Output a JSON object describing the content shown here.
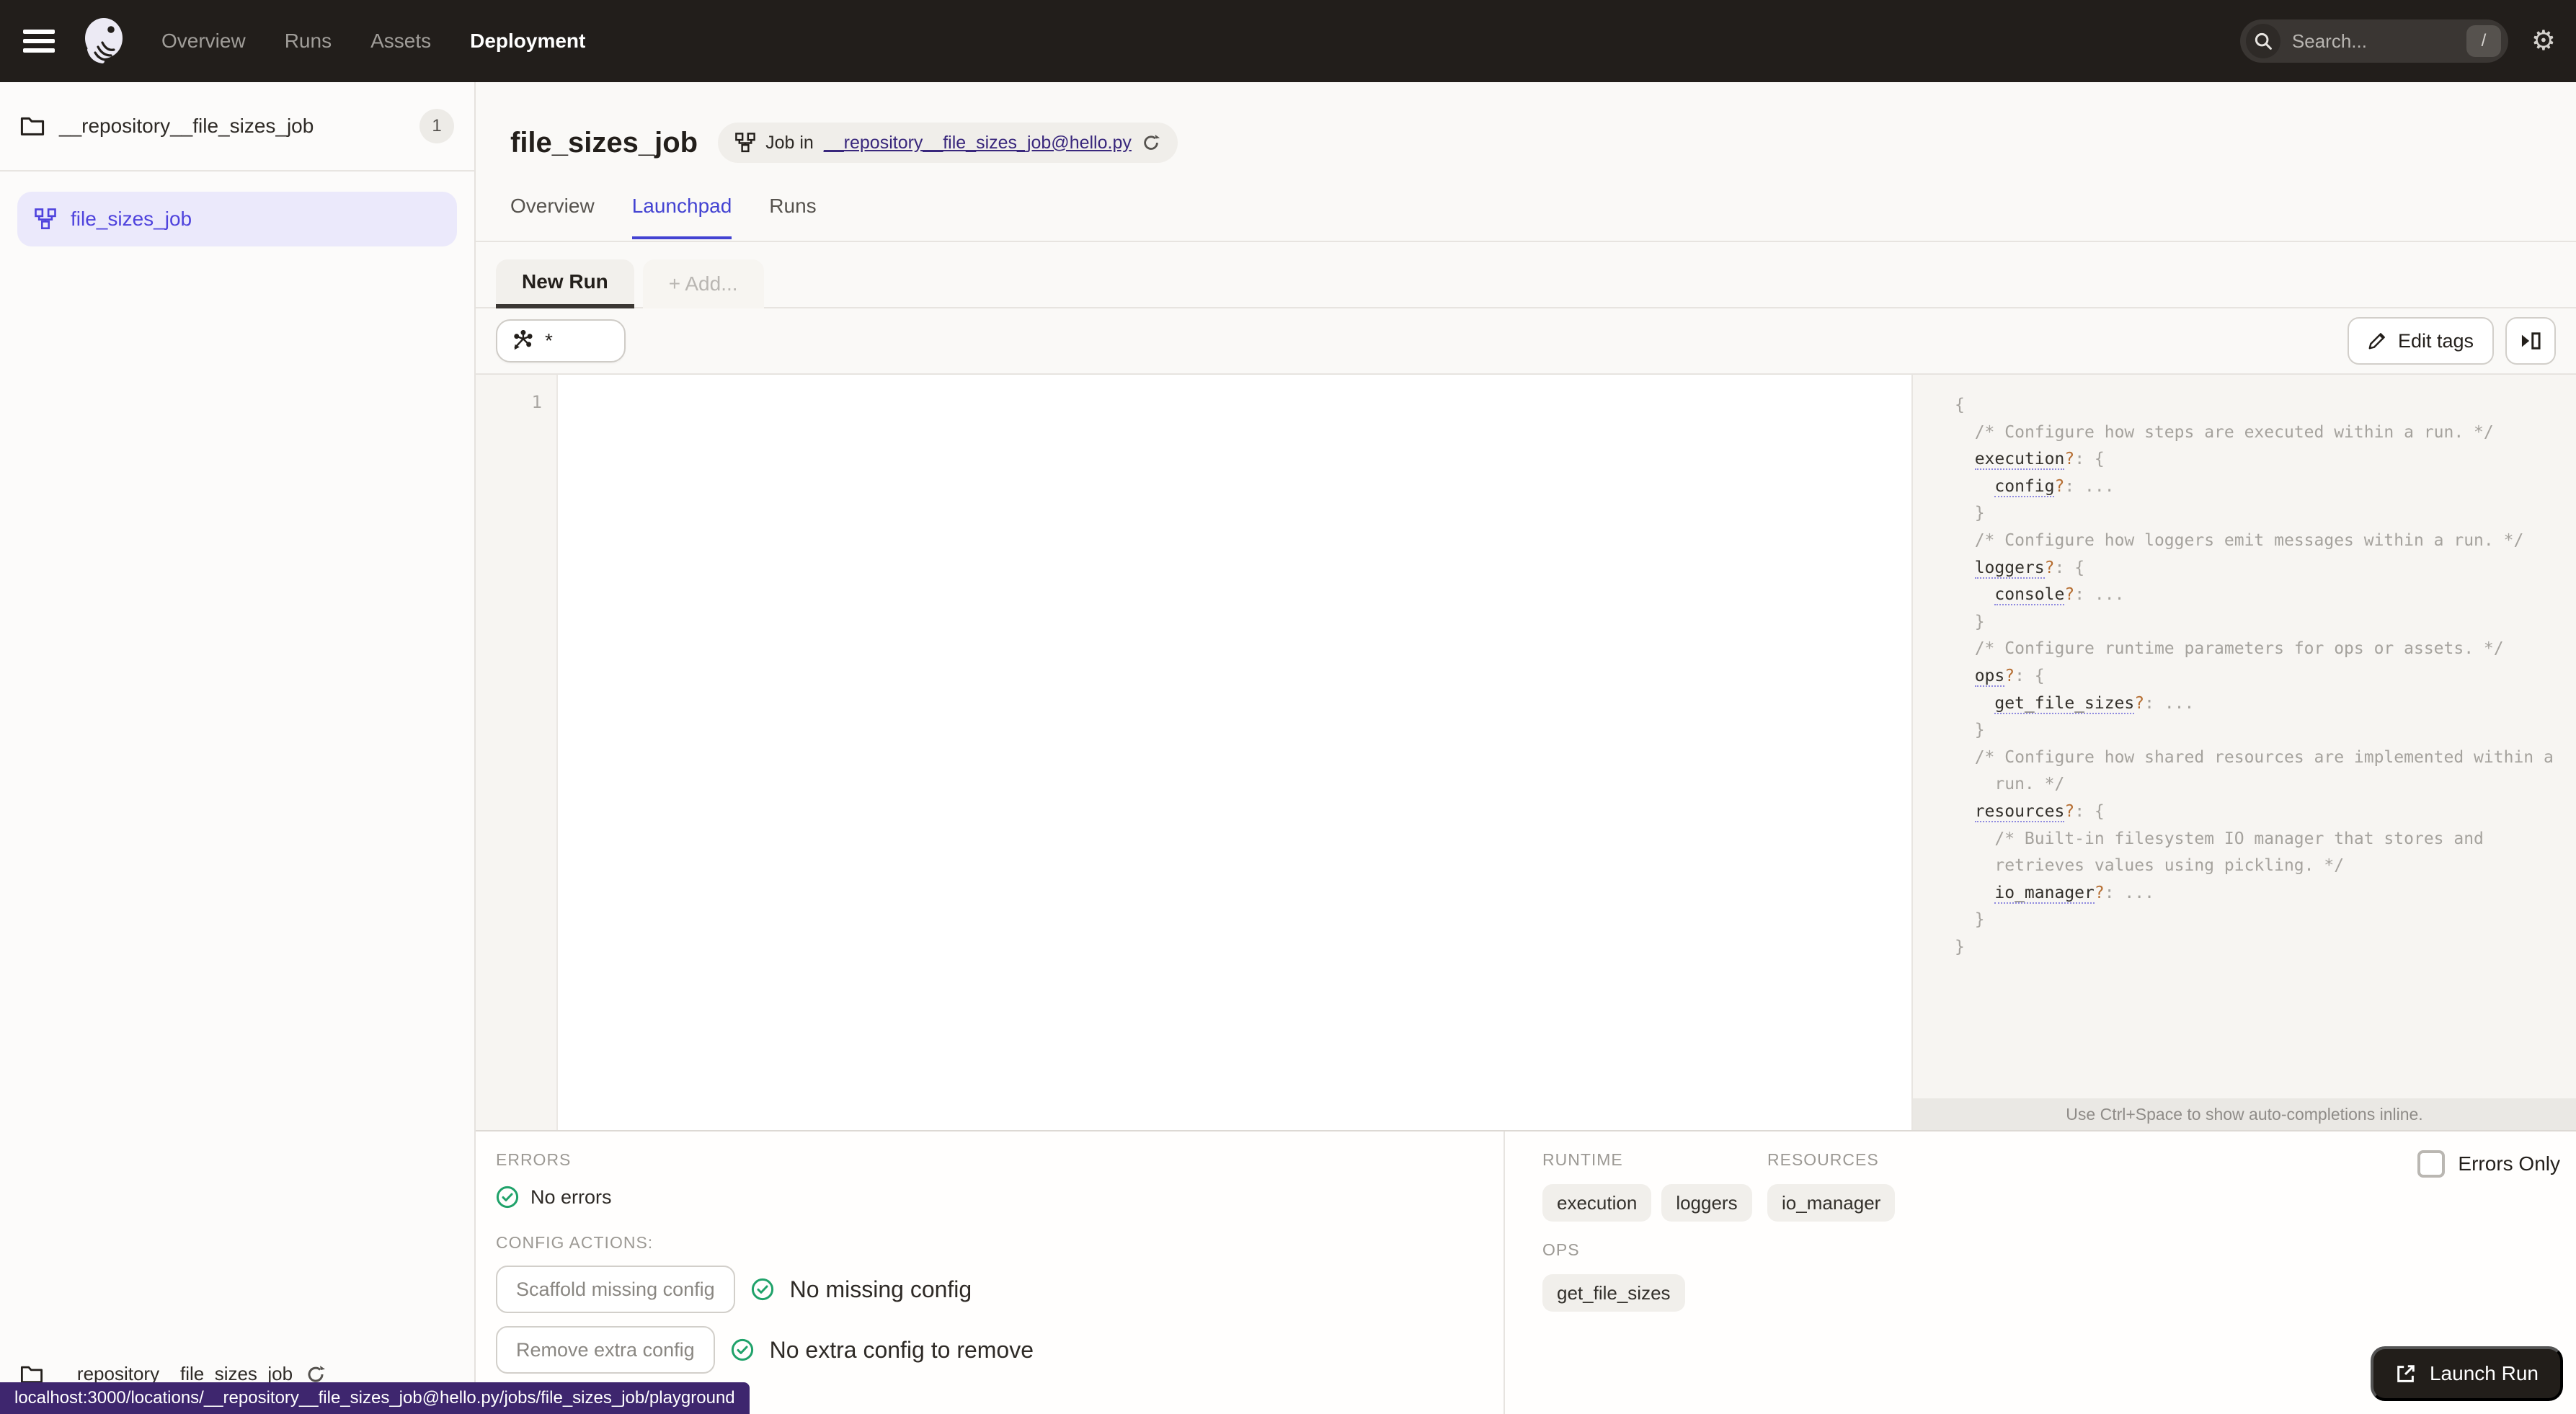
{
  "nav": {
    "items": [
      {
        "label": "Overview"
      },
      {
        "label": "Runs"
      },
      {
        "label": "Assets"
      },
      {
        "label": "Deployment"
      }
    ],
    "search_placeholder": "Search...",
    "search_shortcut": "/"
  },
  "sidebar": {
    "repo_name": "__repository__file_sizes_job",
    "repo_count": "1",
    "job_name": "file_sizes_job",
    "footer_repo_name": "__repository__file_sizes_job"
  },
  "header": {
    "title": "file_sizes_job",
    "job_pill_prefix": "Job in",
    "job_pill_link": "__repository__file_sizes_job@hello.py",
    "tabs": [
      {
        "label": "Overview"
      },
      {
        "label": "Launchpad"
      },
      {
        "label": "Runs"
      }
    ]
  },
  "launchpad": {
    "run_tab_label": "New Run",
    "add_tab_label": "+ Add...",
    "op_selector_value": "*",
    "edit_tags_label": "Edit tags",
    "editor_line_number": "1"
  },
  "config_schema": {
    "hint": "Use Ctrl+Space to show auto-completions inline.",
    "lines": [
      [
        [
          "p",
          "{"
        ]
      ],
      [
        [
          "p",
          "  "
        ],
        [
          "c",
          "/* Configure how steps are executed within a run. */"
        ]
      ],
      [
        [
          "p",
          "  "
        ],
        [
          "k",
          "execution"
        ],
        [
          "q",
          "?"
        ],
        [
          "p",
          ": {"
        ]
      ],
      [
        [
          "p",
          "    "
        ],
        [
          "k",
          "config"
        ],
        [
          "q",
          "?"
        ],
        [
          "p",
          ": ..."
        ]
      ],
      [
        [
          "p",
          "  }"
        ]
      ],
      [
        [
          "p",
          "  "
        ],
        [
          "c",
          "/* Configure how loggers emit messages within a run. */"
        ]
      ],
      [
        [
          "p",
          "  "
        ],
        [
          "k",
          "loggers"
        ],
        [
          "q",
          "?"
        ],
        [
          "p",
          ": {"
        ]
      ],
      [
        [
          "p",
          "    "
        ],
        [
          "k",
          "console"
        ],
        [
          "q",
          "?"
        ],
        [
          "p",
          ": ..."
        ]
      ],
      [
        [
          "p",
          "  }"
        ]
      ],
      [
        [
          "p",
          "  "
        ],
        [
          "c",
          "/* Configure runtime parameters for ops or assets. */"
        ]
      ],
      [
        [
          "p",
          "  "
        ],
        [
          "k",
          "ops"
        ],
        [
          "q",
          "?"
        ],
        [
          "p",
          ": {"
        ]
      ],
      [
        [
          "p",
          "    "
        ],
        [
          "k",
          "get_file_sizes"
        ],
        [
          "q",
          "?"
        ],
        [
          "p",
          ": ..."
        ]
      ],
      [
        [
          "p",
          "  }"
        ]
      ],
      [
        [
          "p",
          "  "
        ],
        [
          "c",
          "/* Configure how shared resources are implemented within a"
        ]
      ],
      [
        [
          "p",
          "    "
        ],
        [
          "c",
          "run. */"
        ]
      ],
      [
        [
          "p",
          "  "
        ],
        [
          "k",
          "resources"
        ],
        [
          "q",
          "?"
        ],
        [
          "p",
          ": {"
        ]
      ],
      [
        [
          "p",
          "    "
        ],
        [
          "c",
          "/* Built-in filesystem IO manager that stores and"
        ]
      ],
      [
        [
          "p",
          "    "
        ],
        [
          "c",
          "retrieves values using pickling. */"
        ]
      ],
      [
        [
          "p",
          "    "
        ],
        [
          "k",
          "io_manager"
        ],
        [
          "q",
          "?"
        ],
        [
          "p",
          ": ..."
        ]
      ],
      [
        [
          "p",
          "  }"
        ]
      ],
      [
        [
          "p",
          "}"
        ]
      ]
    ]
  },
  "bottom_left": {
    "errors_label": "ERRORS",
    "no_errors": "No errors",
    "config_actions_label": "CONFIG ACTIONS:",
    "scaffold_button": "Scaffold missing config",
    "no_missing_config": "No missing config",
    "remove_button": "Remove extra config",
    "no_extra_config": "No extra config to remove"
  },
  "bottom_right": {
    "runtime_label": "RUNTIME",
    "resources_label": "RESOURCES",
    "ops_label": "OPS",
    "runtime_tags": [
      "execution",
      "loggers"
    ],
    "resources_tags": [
      "io_manager"
    ],
    "ops_tags": [
      "get_file_sizes"
    ],
    "errors_only_label": "Errors Only",
    "launch_button": "Launch Run"
  },
  "statusbar": {
    "url": "localhost:3000/locations/__repository__file_sizes_job@hello.py/jobs/file_sizes_job/playground"
  },
  "colors": {
    "accent_blue": "#4f43dd",
    "link_purple": "#39277c",
    "success_green": "#20a26a",
    "statusbar_purple": "#3e266e",
    "schema_question_orange": "#b66e32",
    "topnav_dark": "#221e1b"
  }
}
